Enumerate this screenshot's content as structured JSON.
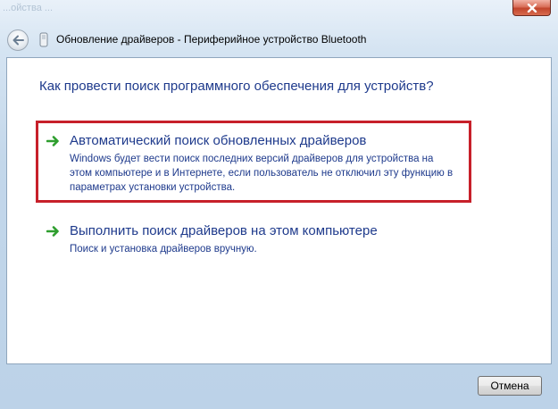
{
  "window": {
    "title": "Обновление драйверов - Периферийное устройство Bluetooth",
    "background_text": "...ойства                                             ..."
  },
  "heading": "Как провести поиск программного обеспечения для устройств?",
  "options": [
    {
      "title": "Автоматический поиск обновленных драйверов",
      "description": "Windows будет вести поиск последних версий драйверов для устройства на этом компьютере и в Интернете, если пользователь не отключил эту функцию в параметрах установки устройства.",
      "highlighted": true
    },
    {
      "title": "Выполнить поиск драйверов на этом компьютере",
      "description": "Поиск и установка драйверов вручную.",
      "highlighted": false
    }
  ],
  "buttons": {
    "cancel": "Отмена"
  },
  "colors": {
    "link_blue": "#1e3a8c",
    "highlight_red": "#c7202a",
    "arrow_green": "#2e9e2e"
  },
  "icons": {
    "back": "back-arrow-icon",
    "device": "bluetooth-device-icon",
    "option_arrow": "green-arrow-icon",
    "close": "close-icon"
  }
}
